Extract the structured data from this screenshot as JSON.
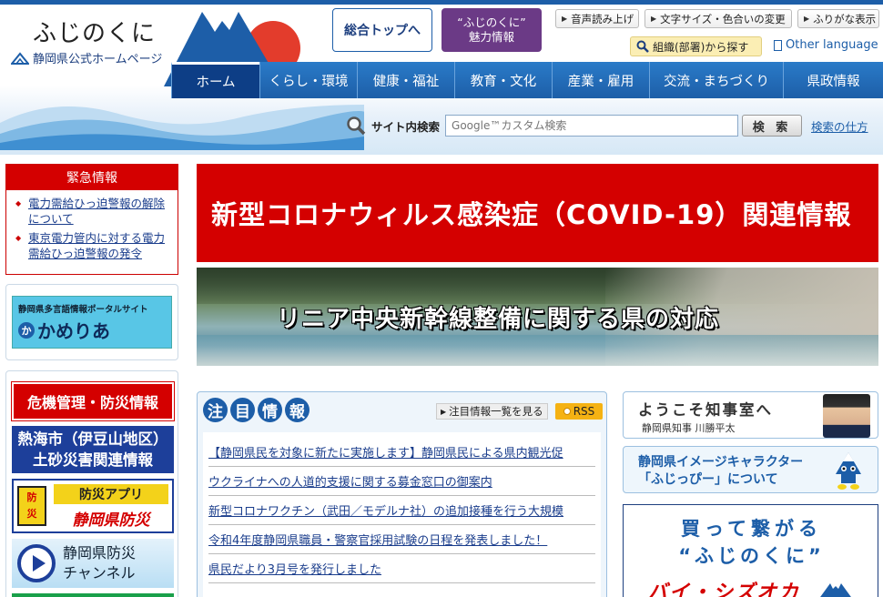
{
  "header": {
    "logo_title": "ふじのくに",
    "logo_sub": "静岡県公式ホームページ",
    "top_button": "総合トップへ",
    "charm_button_line1": "“ふじのくに”",
    "charm_button_line2": "魅力情報",
    "util": {
      "voice": "音声読み上げ",
      "textsize": "文字サイズ・色合いの変更",
      "furigana": "ふりがな表示"
    },
    "org_search": "組織(部署)から探す",
    "other_language": "Other language"
  },
  "nav": {
    "items": [
      {
        "label": "ホーム"
      },
      {
        "label": "くらし・環境"
      },
      {
        "label": "健康・福祉"
      },
      {
        "label": "教育・文化"
      },
      {
        "label": "産業・雇用"
      },
      {
        "label": "交流・まちづくり"
      },
      {
        "label": "県政情報"
      }
    ]
  },
  "search": {
    "label": "サイト内検索",
    "placeholder": "Google™カスタム検索",
    "button": "検 索",
    "howto": "検索の仕方"
  },
  "emergency": {
    "title": "緊急情報",
    "items": [
      {
        "text": "電力需給ひっ迫警報の解除について"
      },
      {
        "text": "東京電力管内に対する電力需給ひっ迫警報の発令"
      }
    ]
  },
  "portal": {
    "small": "静岡県多言語情報ポータルサイト",
    "big": "かめりあ"
  },
  "disaster": {
    "crisis": "危機管理・防災情報",
    "atami_line1": "熱海市（伊豆山地区）",
    "atami_line2": "土砂災害関連情報",
    "app_icon_l1": "防",
    "app_icon_l2": "災",
    "app_line1": "防災アプリ",
    "app_line2": "静岡県防災",
    "channel_line1": "静岡県防災",
    "channel_line2": "チャンネル"
  },
  "banners": {
    "covid": "新型コロナウィルス感染症（COVID-19）関連情報",
    "linear": "リニア中央新幹線整備に関する県の対応"
  },
  "notice": {
    "title_chars": [
      "注",
      "目",
      "情",
      "報"
    ],
    "list_link": "注目情報一覧を見る",
    "rss": "RSS",
    "items": [
      {
        "text": "【静岡県民を対象に新たに実施します】静岡県民による県内観光促"
      },
      {
        "text": "ウクライナへの人道的支援に関する募金窓口の御案内"
      },
      {
        "text": "新型コロナワクチン（武田／モデルナ社）の追加接種を行う大規模"
      },
      {
        "text": "令和4年度静岡県職員・警察官採用試験の日程を発表しました！"
      },
      {
        "text": "県民だより3月号を発行しました"
      }
    ]
  },
  "right": {
    "governor_title": "ようこそ知事室へ",
    "governor_sub": "静岡県知事 川勝平太",
    "character_line1": "静岡県イメージキャラクター",
    "character_line2": "「ふじっぴー」について",
    "buy_line1": "買って繋がる",
    "buy_line2": "“ふじのくに”",
    "buy_line3": "バイ・シズオカ"
  }
}
